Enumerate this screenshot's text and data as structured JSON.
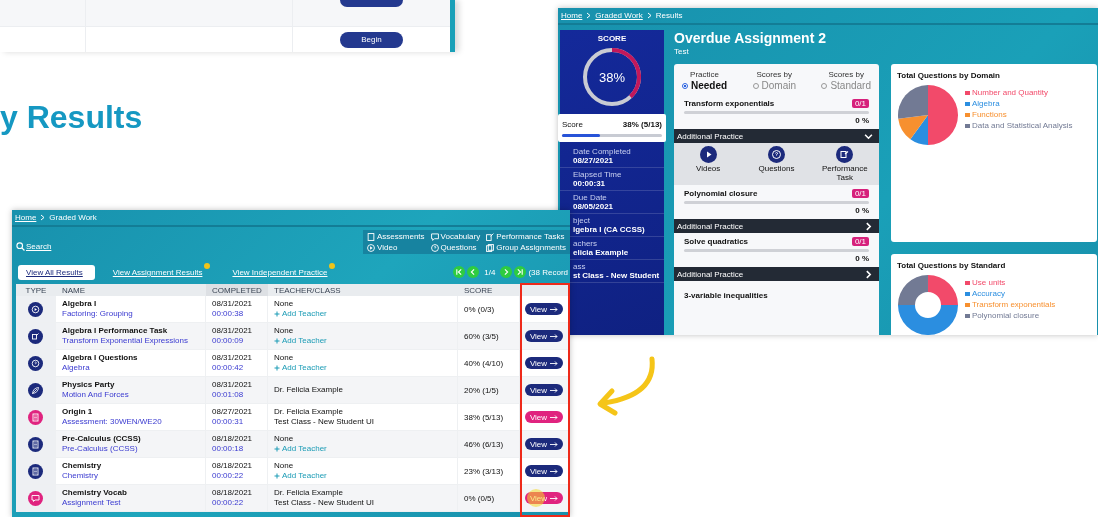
{
  "background_page": {
    "begin_buttons": [
      "Begin"
    ],
    "heading": "y Results"
  },
  "results_window": {
    "breadcrumb": [
      "Home",
      "Graded Work",
      "Results"
    ],
    "score": {
      "label": "SCORE",
      "ring": {
        "text": "38%",
        "level": 0.38
      },
      "bar": {
        "label": "Score",
        "value": "38% (5/13)",
        "level": 0.38
      }
    },
    "details": [
      {
        "label": "Date Completed",
        "value": "08/27/2021"
      },
      {
        "label": "Elapsed Time",
        "value": "00:00:31"
      },
      {
        "label": "Due Date",
        "value": "08/05/2021"
      },
      {
        "label": "bject",
        "value": "lgebra I (CA CCSS)"
      },
      {
        "label": "achers",
        "value": "elicia Example"
      },
      {
        "label": "ass",
        "value": "st Class - New Student"
      }
    ],
    "title": "Overdue Assignment 2",
    "subtitle": "Test",
    "view_options": [
      {
        "small": "Practice",
        "big": "Needed",
        "selected": true
      },
      {
        "small": "Scores by",
        "big": "Domain",
        "selected": false
      },
      {
        "small": "Scores by",
        "big": "Standard",
        "selected": false
      }
    ],
    "items": [
      {
        "kind": "standard",
        "name": "Transform exponentials",
        "badge": "0/1",
        "level": 0,
        "percent": "0 %"
      },
      {
        "kind": "practice",
        "label": "Additional Practice",
        "expanded": true,
        "options": [
          {
            "kind": "video",
            "label": "Videos"
          },
          {
            "kind": "questions",
            "label": "Questions"
          },
          {
            "kind": "task",
            "label": "Performance Task"
          }
        ]
      },
      {
        "kind": "standard",
        "name": "Polynomial closure",
        "badge": "0/1",
        "level": 0,
        "percent": "0 %"
      },
      {
        "kind": "practice",
        "label": "Additional Practice",
        "expanded": false
      },
      {
        "kind": "standard",
        "name": "Solve quadratics",
        "badge": "0/1",
        "level": 0,
        "percent": "0 %"
      },
      {
        "kind": "practice",
        "label": "Additional Practice",
        "expanded": false
      },
      {
        "kind": "cut",
        "name": "3-variable inequalities"
      }
    ],
    "charts": [
      {
        "kind": "pie",
        "title": "Total Questions by Domain",
        "legend": [
          {
            "label": "Number and Quantity",
            "color": "#f24a6a"
          },
          {
            "label": "Algebra",
            "color": "#2b8ee0"
          },
          {
            "label": "Functions",
            "color": "#f7902f"
          },
          {
            "label": "Data and Statistical Analysis",
            "color": "#727a94"
          }
        ]
      },
      {
        "kind": "donut",
        "title": "Total Questions by Standard",
        "legend": [
          {
            "label": "Use units",
            "color": "#f24a6a"
          },
          {
            "label": "Accuracy",
            "color": "#2b8ee0"
          },
          {
            "label": "Transform exponentials",
            "color": "#f7902f"
          },
          {
            "label": "Polynomial closure",
            "color": "#727a94"
          }
        ]
      }
    ]
  },
  "graded_window": {
    "breadcrumb": [
      "Home",
      "Graded Work"
    ],
    "search": "Search",
    "legend": [
      {
        "kind": "assessment",
        "label": "Assessments"
      },
      {
        "kind": "vocabulary",
        "label": "Vocabulary"
      },
      {
        "kind": "task",
        "label": "Performance Tasks"
      },
      {
        "kind": "video",
        "label": "Video"
      },
      {
        "kind": "questions",
        "label": "Questions"
      },
      {
        "kind": "group",
        "label": "Group Assignments"
      }
    ],
    "tabs": [
      {
        "label": "View All Results",
        "selected": true,
        "badge": false
      },
      {
        "label": "View Assignment Results",
        "selected": false,
        "badge": true
      },
      {
        "label": "View Independent Practice",
        "selected": false,
        "badge": true
      }
    ],
    "pagination": {
      "page": "1/4",
      "records": "(38 Record"
    },
    "columns": [
      "TYPE",
      "NAME",
      "COMPLETED",
      "TEACHER/CLASS",
      "SCORE"
    ],
    "rows": [
      {
        "kind": "video",
        "color": "#1c2a7c",
        "name": "Algebra I",
        "topic": "Factoring: Grouping",
        "date": "08/31/2021",
        "time": "00:00:38",
        "teacher": "None",
        "link": "Add Teacher",
        "score": "0% (0/3)",
        "action": "View",
        "highlighted": false
      },
      {
        "kind": "task",
        "color": "#1c2a7c",
        "name": "Algebra I Performance Task",
        "topic": "Transform Exponential Expressions",
        "date": "08/31/2021",
        "time": "00:00:09",
        "teacher": "None",
        "link": "Add Teacher",
        "score": "60% (3/5)",
        "action": "View",
        "highlighted": false
      },
      {
        "kind": "questions",
        "color": "#1c2a7c",
        "name": "Algebra I Questions",
        "topic": "Algebra",
        "date": "08/31/2021",
        "time": "00:00:42",
        "teacher": "None",
        "link": "Add Teacher",
        "score": "40% (4/10)",
        "action": "View",
        "highlighted": false
      },
      {
        "kind": "group",
        "color": "#1c2a7c",
        "name": "Physics Party",
        "topic": "Motion And Forces",
        "date": "08/31/2021",
        "time": "00:01:08",
        "teacher": "Dr. Felicia Example",
        "score": "20% (1/5)",
        "action": "View",
        "highlighted": false
      },
      {
        "kind": "assessment",
        "color": "#e0237f",
        "name": "Origin 1",
        "topic": "Assessment: 30WEN/WE20",
        "date": "08/27/2021",
        "time": "00:00:31",
        "teacher": "Dr. Felicia Example",
        "class": "Test Class - New Student UI",
        "score": "38% (5/13)",
        "action": "View",
        "highlighted": false
      },
      {
        "kind": "assessment",
        "color": "#1c2a7c",
        "name": "Pre-Calculus (CCSS)",
        "topic": "Pre-Calculus (CCSS)",
        "date": "08/18/2021",
        "time": "00:00:18",
        "teacher": "None",
        "link": "Add Teacher",
        "score": "46% (6/13)",
        "action": "View",
        "highlighted": false
      },
      {
        "kind": "assessment",
        "color": "#1c2a7c",
        "name": "Chemistry",
        "topic": "Chemistry",
        "date": "08/18/2021",
        "time": "00:00:22",
        "teacher": "None",
        "link": "Add Teacher",
        "score": "23% (3/13)",
        "action": "View",
        "highlighted": false
      },
      {
        "kind": "vocabulary",
        "color": "#e0237f",
        "name": "Chemistry Vocab",
        "topic": "Assignment Test",
        "date": "08/18/2021",
        "time": "00:00:22",
        "teacher": "Dr. Felicia Example",
        "class": "Test Class - New Student UI",
        "score": "0% (0/5)",
        "action": "View",
        "highlighted": true
      }
    ]
  }
}
